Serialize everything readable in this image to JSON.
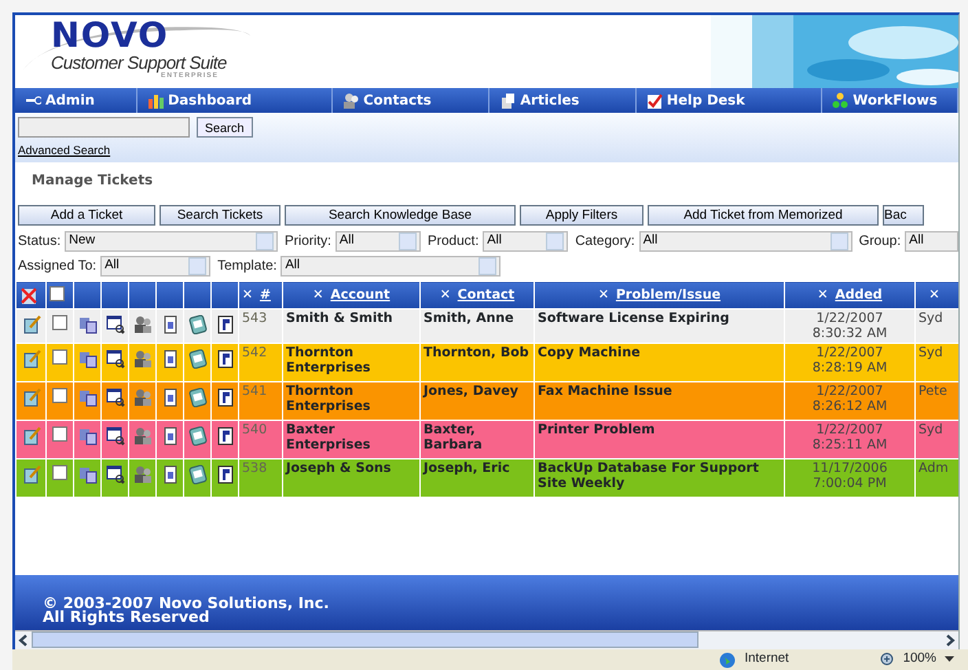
{
  "header": {
    "logo": "NOVO",
    "subtitle": "Customer Support Suite",
    "edition": "ENTERPRISE"
  },
  "nav": [
    {
      "label": "Admin"
    },
    {
      "label": "Dashboard"
    },
    {
      "label": "Contacts"
    },
    {
      "label": "Articles"
    },
    {
      "label": "Help Desk"
    },
    {
      "label": "WorkFlows"
    }
  ],
  "search": {
    "button": "Search",
    "advanced_link": "Advanced Search"
  },
  "page_title": "Manage Tickets",
  "buttons": [
    "Add a Ticket",
    "Search Tickets",
    "Search Knowledge Base",
    "Apply Filters",
    "Add Ticket from Memorized",
    "Bac"
  ],
  "filter_rows": [
    [
      {
        "label": "Status:",
        "value": "New"
      },
      {
        "label": "Priority:",
        "value": "All"
      },
      {
        "label": "Product:",
        "value": "All"
      },
      {
        "label": "Category:",
        "value": "All"
      },
      {
        "label": "Group:",
        "value": "All"
      }
    ],
    [
      {
        "label": "Assigned To:",
        "value": "All"
      },
      {
        "label": "Template:",
        "value": "All"
      }
    ]
  ],
  "table": {
    "header_checkbox": {
      "checked": false
    },
    "columns": [
      {
        "mark": "✕",
        "label": "#"
      },
      {
        "mark": "✕",
        "label": "Account"
      },
      {
        "mark": "✕",
        "label": "Contact"
      },
      {
        "mark": "✕",
        "label": "Problem/Issue"
      },
      {
        "mark": "✕",
        "label": "Added"
      },
      {
        "mark": "✕"
      }
    ],
    "rows": [
      {
        "color": "#efefef",
        "checked": false,
        "number": "543",
        "account": "Smith & Smith",
        "contact": "Smith, Anne",
        "problem": "Software License Expiring",
        "date": "1/22/2007",
        "time": "8:30:32 AM",
        "column_10": "Syd"
      },
      {
        "color": "#fbc400",
        "checked": false,
        "number": "542",
        "account": "Thornton Enterprises",
        "contact": "Thornton, Bob",
        "problem": "Copy Machine",
        "date": "1/22/2007",
        "time": "8:28:19 AM",
        "column_10": "Syd"
      },
      {
        "color": "#fa9400",
        "checked": false,
        "number": "541",
        "account": "Thornton Enterprises",
        "contact": "Jones, Davey",
        "problem": "Fax Machine Issue",
        "date": "1/22/2007",
        "time": "8:26:12 AM",
        "column_10": "Pete"
      },
      {
        "color": "#f7648a",
        "checked": false,
        "number": "540",
        "account": "Baxter Enterprises",
        "contact": "Baxter, Barbara",
        "problem": "Printer Problem",
        "date": "1/22/2007",
        "time": "8:25:11 AM",
        "column_10": "Syd"
      },
      {
        "color": "#7cc11a",
        "checked": false,
        "number": "538",
        "account": "Joseph & Sons",
        "contact": "Joseph, Eric",
        "problem": "BackUp Database For Support Site Weekly",
        "date": "11/17/2006",
        "time": "7:00:04 PM",
        "column_10": "Adm"
      }
    ]
  },
  "footer": {
    "copyright": "© 2003-2007 Novo Solutions, Inc.",
    "rights": "All Rights Reserved"
  },
  "status_bar": {
    "zone": "Internet",
    "zoom": "100%"
  }
}
